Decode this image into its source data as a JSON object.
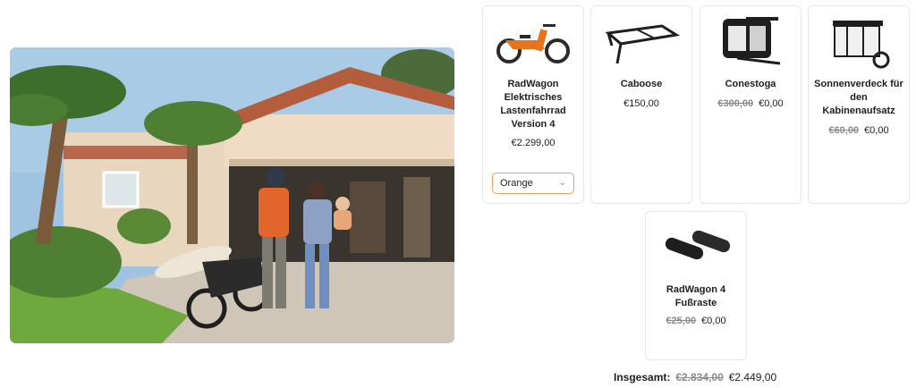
{
  "hero": {
    "image": "family-with-cargo-ebike-in-driveway"
  },
  "products": [
    {
      "name": "RadWagon Elektrisches Lastenfahrrad Version 4",
      "image": "orange-cargo-ebike",
      "old_price": "",
      "price": "€2.299,00",
      "variant": "Orange"
    },
    {
      "name": "Caboose",
      "image": "rear-rack-frame",
      "old_price": "",
      "price": "€150,00"
    },
    {
      "name": "Conestoga",
      "image": "cabin-enclosure",
      "old_price": "€300,00",
      "price": "€0,00"
    },
    {
      "name": "Sonnenverdeck für den Kabinenaufsatz",
      "image": "canopy-on-cabin",
      "old_price": "€60,00",
      "price": "€0,00"
    },
    {
      "name": "RadWagon 4 Fußraste",
      "image": "foot-pegs",
      "old_price": "€25,00",
      "price": "€0,00"
    }
  ],
  "summary": {
    "label": "Insgesamt:",
    "old_total": "€2.834,00",
    "total": "€2.449,00"
  },
  "colors": {
    "accent_orange": "#e8731e",
    "select_border": "#e8a268",
    "strike_gray": "#8a8a8a"
  }
}
